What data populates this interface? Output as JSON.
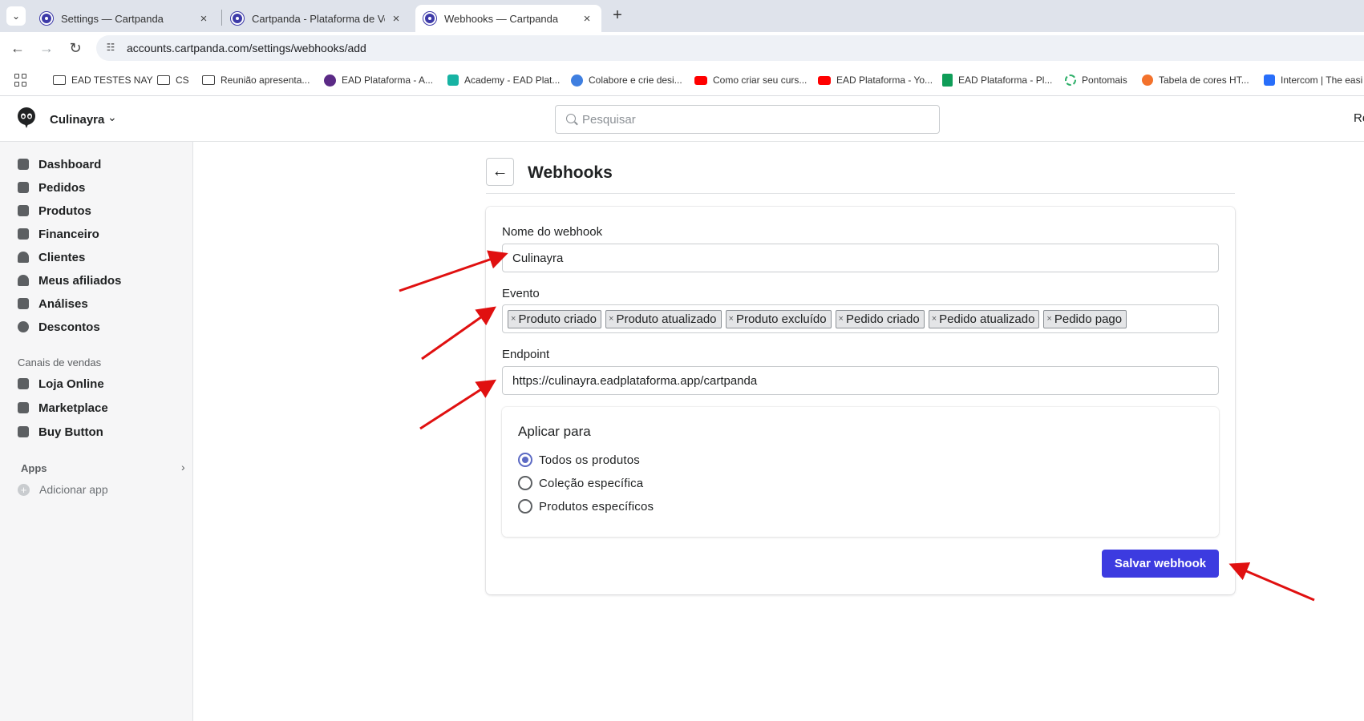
{
  "browser": {
    "tabs": [
      {
        "title": "Settings — Cartpanda",
        "close": "×"
      },
      {
        "title": "Cartpanda - Plataforma de Vendas",
        "close": "×"
      },
      {
        "title": "Webhooks — Cartpanda",
        "close": "×"
      }
    ],
    "new_tab": "+",
    "url": "accounts.cartpanda.com/settings/webhooks/add",
    "bookmarks": [
      {
        "label": "EAD TESTES NAY",
        "icon": "folder-icon"
      },
      {
        "label": "CS",
        "icon": "folder-icon"
      },
      {
        "label": "Reunião apresenta...",
        "icon": "folder-icon"
      },
      {
        "label": "EAD Plataforma - A...",
        "icon": "ead-icon"
      },
      {
        "label": "Academy - EAD Plat...",
        "icon": "academy-icon"
      },
      {
        "label": "Colabore e crie desi...",
        "icon": "canva-icon"
      },
      {
        "label": "Como criar seu curs...",
        "icon": "youtube-icon"
      },
      {
        "label": "EAD Plataforma - Yo...",
        "icon": "youtube-icon"
      },
      {
        "label": "EAD Plataforma - Pl...",
        "icon": "sheets-icon"
      },
      {
        "label": "Pontomais",
        "icon": "pontomais-icon"
      },
      {
        "label": "Tabela de cores HT...",
        "icon": "orange-icon"
      },
      {
        "label": "Intercom | The easi",
        "icon": "intercom-icon"
      }
    ]
  },
  "header": {
    "store_name": "Culinayra",
    "search_placeholder": "Pesquisar",
    "right_text": "Re"
  },
  "sidebar": {
    "items": [
      {
        "label": "Dashboard"
      },
      {
        "label": "Pedidos"
      },
      {
        "label": "Produtos"
      },
      {
        "label": "Financeiro"
      },
      {
        "label": "Clientes"
      },
      {
        "label": "Meus afiliados"
      },
      {
        "label": "Análises"
      },
      {
        "label": "Descontos"
      }
    ],
    "sales_channels_label": "Canais de vendas",
    "channels": [
      {
        "label": "Loja Online"
      },
      {
        "label": "Marketplace"
      },
      {
        "label": "Buy Button"
      }
    ],
    "apps_label": "Apps",
    "add_app_label": "Adicionar app"
  },
  "page": {
    "title": "Webhooks",
    "form": {
      "name_label": "Nome do webhook",
      "name_value": "Culinayra",
      "event_label": "Evento",
      "events": [
        "Produto criado",
        "Produto atualizado",
        "Produto excluído",
        "Pedido criado",
        "Pedido atualizado",
        "Pedido pago"
      ],
      "endpoint_label": "Endpoint",
      "endpoint_value": "https://culinayra.eadplataforma.app/cartpanda",
      "apply_title": "Aplicar para",
      "apply_options": [
        {
          "label": "Todos os produtos",
          "checked": true
        },
        {
          "label": "Coleção específica",
          "checked": false
        },
        {
          "label": "Produtos específicos",
          "checked": false
        }
      ],
      "save_label": "Salvar webhook"
    }
  },
  "colors": {
    "primary_button": "#3c3be0",
    "annotation_arrow": "#e01010",
    "radio_checked": "#5c6ac4"
  }
}
